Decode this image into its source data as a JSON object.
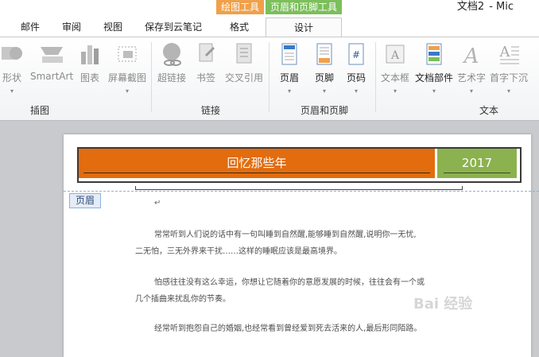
{
  "window": {
    "doc_title": "文档2",
    "app_suffix": "- Mic"
  },
  "context_tabs": {
    "drawing_tools": "绘图工具",
    "header_footer_tools": "页眉和页脚工具"
  },
  "tabs": [
    "邮件",
    "审阅",
    "视图",
    "保存到云笔记",
    "格式",
    "设计"
  ],
  "ribbon": {
    "illustrations": {
      "group_label": "插图",
      "items": [
        "形状",
        "SmartArt",
        "图表",
        "屏幕截图"
      ]
    },
    "links": {
      "group_label": "链接",
      "items": [
        "超链接",
        "书签",
        "交叉引用"
      ]
    },
    "header_footer": {
      "group_label": "页眉和页脚",
      "items": [
        "页眉",
        "页脚",
        "页码"
      ]
    },
    "text": {
      "group_label": "文本",
      "items": [
        "文本框",
        "文档部件",
        "艺术字",
        "首字下沉"
      ]
    }
  },
  "document": {
    "header_title": "回忆那些年",
    "header_year": "2017",
    "header_tag": "页眉",
    "paragraphs": [
      "常常听到人们说的话中有一句叫睡到自然醒,能够睡到自然醒,说明你一无忧,",
      "二无怕，三无外界来干扰……这样的睡眠应该是最高境界。",
      "怕感往往没有这么幸运，你想让它随着你的意愿发展的时候，往往会有一个或",
      "几个插曲来扰乱你的节奏。",
      "经常听到抱怨自己的婚姻,也经常看到曾经爱到死去活来的人,最后形同陌路。"
    ],
    "watermark": "Bai 经验"
  }
}
